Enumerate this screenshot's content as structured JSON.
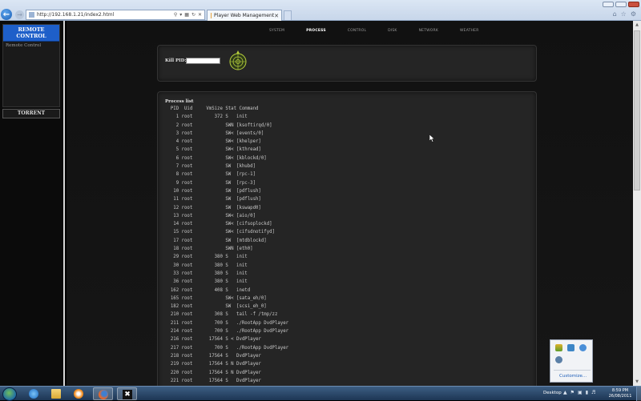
{
  "browser": {
    "url": "http://192.168.1.21/index2.html",
    "tab_title": "Player Web Management"
  },
  "sidebar": {
    "remote_header": "REMOTE CONTROL",
    "remote_link": "Remote Control",
    "torrent_label": "TORRENT"
  },
  "nav": {
    "items": [
      "SYSTEM",
      "PROCESS",
      "CONTROL",
      "DISK",
      "NETWORK",
      "WEATHER"
    ],
    "active": "PROCESS"
  },
  "kill": {
    "label": "Kill PID:",
    "icon": "crosshair-target-icon"
  },
  "process": {
    "title": "Process list",
    "header": "  PID  Uid     VmSize Stat Command",
    "rows": [
      "    1 root        372 S   init",
      "    2 root            SWN [ksoftirqd/0]",
      "    3 root            SW< [events/0]",
      "    4 root            SW< [khelper]",
      "    5 root            SW< [kthread]",
      "    6 root            SW< [kblockd/0]",
      "    7 root            SW  [khubd]",
      "    8 root            SW  [rpc-1]",
      "    9 root            SW  [rpc-3]",
      "   10 root            SW  [pdflush]",
      "   11 root            SW  [pdflush]",
      "   12 root            SW  [kswapd0]",
      "   13 root            SW< [aio/0]",
      "   14 root            SW< [cifsoplockd]",
      "   15 root            SW< [cifsdnotifyd]",
      "   17 root            SW  [mtdblockd]",
      "   18 root            SWN [eth0]",
      "   29 root        380 S   init",
      "   30 root        380 S   init",
      "   33 root        380 S   init",
      "   36 root        380 S   init",
      "  162 root        408 S   inetd",
      "  165 root            SW< [sata_eh/0]",
      "  182 root            SW  [scsi_eh_0]",
      "  210 root        308 S   tail -f /tmp/zz",
      "  211 root        700 S   ./RootApp DvdPlayer",
      "  214 root        700 S   ./RootApp DvdPlayer",
      "  216 root      17564 S < DvdPlayer",
      "  217 root        700 S   ./RootApp DvdPlayer",
      "  218 root      17564 S   DvdPlayer",
      "  219 root      17564 S N DvdPlayer",
      "  220 root      17564 S N DvdPlayer",
      "  221 root      17564 S   DvdPlayer"
    ]
  },
  "tray_popup": {
    "customize": "Customize..."
  },
  "taskbar": {
    "desktop_label": "Desktop",
    "time": "8:59 PM",
    "date": "26/08/2011"
  },
  "colors": {
    "remote_header_bg": "#1e5fc9",
    "page_bg": "#000000",
    "panel_bg": "#252525"
  }
}
